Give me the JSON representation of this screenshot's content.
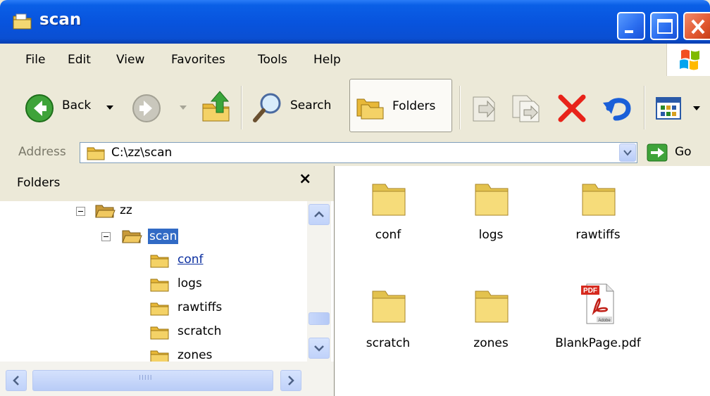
{
  "window": {
    "title": "scan",
    "colors": {
      "titlebar": "#0a5fe6",
      "selection": "#316ac5"
    }
  },
  "menu": {
    "items": [
      "File",
      "Edit",
      "View",
      "Favorites",
      "Tools",
      "Help"
    ]
  },
  "toolbar": {
    "back_label": "Back",
    "search_label": "Search",
    "folders_label": "Folders"
  },
  "address": {
    "label": "Address",
    "value": "C:\\zz\\scan",
    "go_label": "Go"
  },
  "folders_pane": {
    "title": "Folders",
    "close_glyph": "×",
    "tree": [
      {
        "label": "zz",
        "state": "expanded"
      },
      {
        "label": "scan",
        "state": "expanded-selected"
      },
      {
        "label": "conf",
        "state": "hover-link"
      },
      {
        "label": "logs"
      },
      {
        "label": "rawtiffs"
      },
      {
        "label": "scratch"
      },
      {
        "label": "zones"
      }
    ],
    "hscroll_grip": "IIIII"
  },
  "files": [
    {
      "name": "conf",
      "icon": "folder-icon"
    },
    {
      "name": "logs",
      "icon": "folder-icon"
    },
    {
      "name": "rawtiffs",
      "icon": "folder-icon"
    },
    {
      "name": "scratch",
      "icon": "folder-icon"
    },
    {
      "name": "zones",
      "icon": "folder-icon"
    },
    {
      "name": "BlankPage.pdf",
      "icon": "pdf-icon"
    }
  ],
  "pdf_icon_text": {
    "badge": "PDF",
    "brand": "Adobe"
  }
}
